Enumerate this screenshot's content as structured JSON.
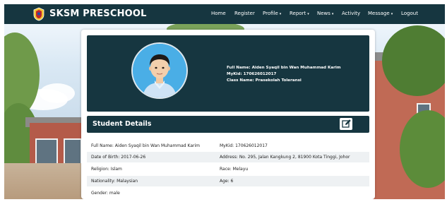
{
  "navbar": {
    "brand": "SKSM PRESCHOOL",
    "items": [
      {
        "label": "Home",
        "caret": ""
      },
      {
        "label": "Register",
        "caret": ""
      },
      {
        "label": "Profile",
        "caret": "▾"
      },
      {
        "label": "Report",
        "caret": "▾"
      },
      {
        "label": "News",
        "caret": "▾"
      },
      {
        "label": "Activity",
        "caret": ""
      },
      {
        "label": "Message",
        "caret": "▾"
      },
      {
        "label": "Logout",
        "caret": ""
      }
    ]
  },
  "profile": {
    "full_name": "Full Name: Aiden Syaqil bin Wan Muhammad Karim",
    "mykid": "MyKid: 170626012017",
    "class_name": "Class Name: Prasekolah Toleransi"
  },
  "details": {
    "title": "Student Details",
    "edit_icon": "edit-icon",
    "rows": [
      {
        "left": "Full Name: Aiden Syaqil bin Wan Muhammad Karim",
        "right": "MyKid: 170626012017"
      },
      {
        "left": "Date of Birth: 2017-06-26",
        "right": "Address: No. 295, Jalan Kangkung 2, 81900 Kota Tinggi, Johor"
      },
      {
        "left": "Religion: Islam",
        "right": "Race: Melayu"
      },
      {
        "left": "Nationality: Malaysian",
        "right": "Age: 6"
      },
      {
        "left": "Gender: male",
        "right": ""
      }
    ]
  },
  "colors": {
    "navbar": "#163640",
    "panel": "#163640",
    "row_alt": "#eef1f3"
  }
}
